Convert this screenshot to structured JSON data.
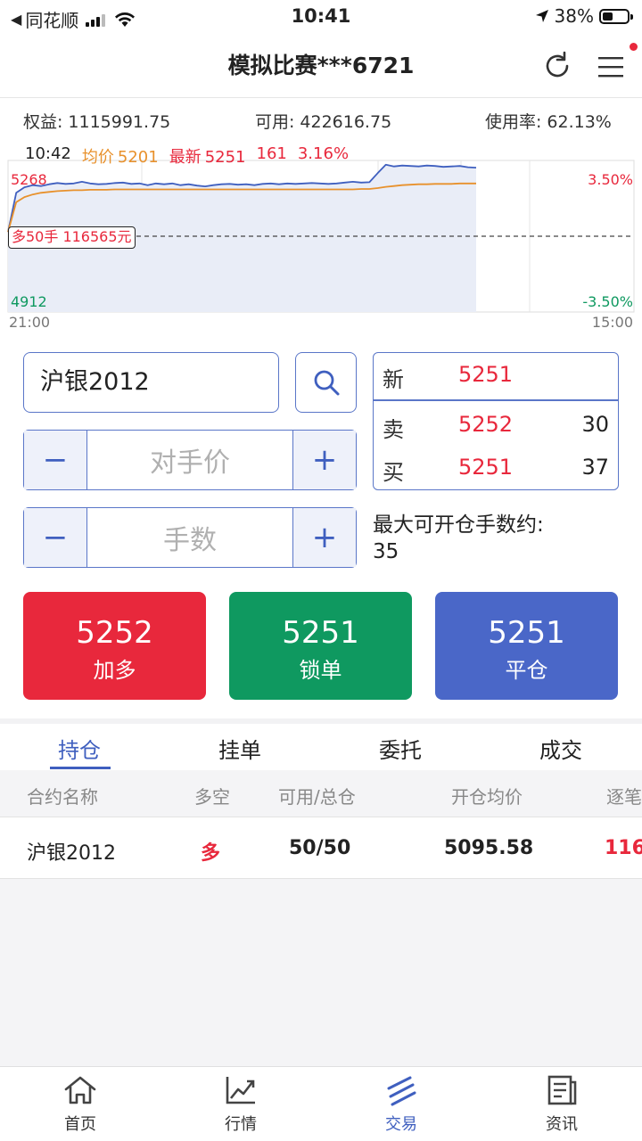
{
  "status_bar": {
    "back_arrow": "◀",
    "carrier": "同花顺",
    "time": "10:41",
    "battery": "38%"
  },
  "nav": {
    "title": "模拟比赛***6721"
  },
  "account": {
    "equity_label": "权益:",
    "equity_value": "1115991.75",
    "available_label": "可用:",
    "available_value": "422616.75",
    "usage_label": "使用率:",
    "usage_value": "62.13%"
  },
  "chart": {
    "time": "10:42",
    "avg_label": "均价",
    "avg_value": "5201",
    "last_label": "最新",
    "last_value": "5251",
    "change": "161",
    "change_pct": "3.16%",
    "y_high": "5268",
    "y_low": "4912",
    "pct_high": "3.50%",
    "pct_low": "-3.50%",
    "x_start": "21:00",
    "x_end": "15:00",
    "position_label": "多50手  116565元"
  },
  "chart_data": {
    "type": "line",
    "ylim": [
      4912,
      5268
    ],
    "baseline": 5090,
    "series": [
      {
        "role": "price",
        "color": "#3f5fbf",
        "values": [
          5100,
          5192,
          5205,
          5210,
          5208,
          5212,
          5215,
          5213,
          5214,
          5218,
          5214,
          5212,
          5213,
          5215,
          5216,
          5213,
          5214,
          5210,
          5214,
          5212,
          5214,
          5210,
          5212,
          5209,
          5207,
          5210,
          5212,
          5213,
          5211,
          5212,
          5210,
          5213,
          5214,
          5212,
          5214,
          5213,
          5214,
          5215,
          5214,
          5213,
          5214,
          5216,
          5218,
          5216,
          5217,
          5238,
          5258,
          5254,
          5256,
          5255,
          5254,
          5256,
          5255,
          5253,
          5254,
          5255,
          5252,
          5251
        ]
      },
      {
        "role": "average",
        "color": "#e8912c",
        "values": [
          5100,
          5170,
          5182,
          5188,
          5192,
          5194,
          5196,
          5197,
          5198,
          5198,
          5199,
          5199,
          5199,
          5200,
          5200,
          5200,
          5200,
          5200,
          5200,
          5200,
          5200,
          5200,
          5200,
          5200,
          5200,
          5200,
          5200,
          5200,
          5200,
          5200,
          5200,
          5200,
          5200,
          5200,
          5200,
          5200,
          5200,
          5200,
          5200,
          5200,
          5200,
          5200,
          5200,
          5201,
          5201,
          5203,
          5206,
          5208,
          5210,
          5211,
          5212,
          5212,
          5213,
          5213,
          5213,
          5214,
          5214,
          5214
        ]
      }
    ]
  },
  "order": {
    "contract": "沪银2012",
    "price_placeholder": "对手价",
    "qty_placeholder": "手数",
    "minus": "−",
    "plus": "+"
  },
  "quote": {
    "new_label": "新",
    "new_price": "5251",
    "ask_label": "卖",
    "ask_price": "5252",
    "ask_qty": "30",
    "bid_label": "买",
    "bid_price": "5251",
    "bid_qty": "37"
  },
  "max_open": {
    "label": "最大可开仓手数约:",
    "value": "35"
  },
  "actions": {
    "add_long": {
      "price": "5252",
      "label": "加多",
      "color": "#e8283c"
    },
    "lock": {
      "price": "5251",
      "label": "锁单",
      "color": "#0f9960"
    },
    "close": {
      "price": "5251",
      "label": "平仓",
      "color": "#4a67c8"
    }
  },
  "tabs": [
    "持仓",
    "挂单",
    "委托",
    "成交"
  ],
  "table": {
    "headers": [
      "合约名称",
      "多空",
      "可用/总仓",
      "开仓均价",
      "逐笔"
    ],
    "rows": [
      {
        "name": "沪银2012",
        "side": "多",
        "avail_total": "50/50",
        "avg_open": "5095.58",
        "pnl": "116"
      }
    ]
  },
  "bottom_tabs": [
    "首页",
    "行情",
    "交易",
    "资讯"
  ]
}
